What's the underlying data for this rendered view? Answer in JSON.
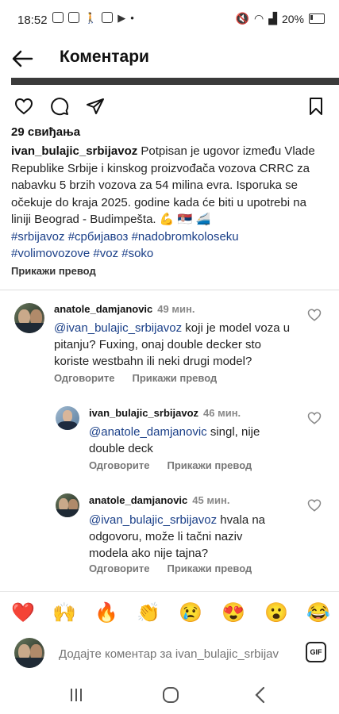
{
  "status_bar": {
    "time": "18:52",
    "battery": "20%"
  },
  "header": {
    "title": "Коментари"
  },
  "post": {
    "likes": "29 свиђања",
    "username": "ivan_bulajic_srbijavoz",
    "caption": " Potpisan je ugovor između Vlade Republike Srbije i kinskog proizvođača vozova CRRC za nabavku 5 brzih vozova za 54 milina evra. Isporuka se očekuje do kraja 2025. godine kada će biti u upotrebi na liniji Beograd - Budimpešta. 💪 🇷🇸 🚄",
    "hashtags_line1": [
      "#srbijavoz",
      "#србијавоз",
      "#nadobromkoloseku"
    ],
    "hashtags_line2": [
      "#volimovozove",
      "#voz",
      "#soko"
    ],
    "translate_label": "Прикажи превод"
  },
  "comments": [
    {
      "username": "anatole_damjanovic",
      "time": "49 мин.",
      "mention": "@ivan_bulajic_srbijavoz",
      "text": " koji je model voza u pitanju? Fuxing, onaj double decker sto koriste westbahn ili neki drugi model?",
      "reply_label": "Одговорите",
      "translate_label": "Прикажи превод"
    },
    {
      "username": "ivan_bulajic_srbijavoz",
      "time": "46 мин.",
      "mention": "@anatole_damjanovic",
      "text": " singl, nije double deck",
      "reply_label": "Одговорите",
      "translate_label": "Прикажи превод"
    },
    {
      "username": "anatole_damjanovic",
      "time": "45 мин.",
      "mention": "@ivan_bulajic_srbijavoz",
      "text": " hvala na odgovoru, može li tačni naziv modela ako nije tajna?",
      "reply_label": "Одговорите",
      "translate_label": "Прикажи превод"
    }
  ],
  "emoji_bar": [
    "❤️",
    "🙌",
    "🔥",
    "👏",
    "😢",
    "😍",
    "😮",
    "😂"
  ],
  "comment_input": {
    "placeholder": "Додајте коментар за ivan_bulajic_srbijav",
    "gif_label": "GIF"
  },
  "icons": [
    "back-arrow-icon",
    "heart-icon",
    "comment-icon",
    "share-icon",
    "bookmark-icon",
    "gif-icon"
  ],
  "colors": {
    "link": "#1a3f88",
    "meta": "#777777"
  }
}
